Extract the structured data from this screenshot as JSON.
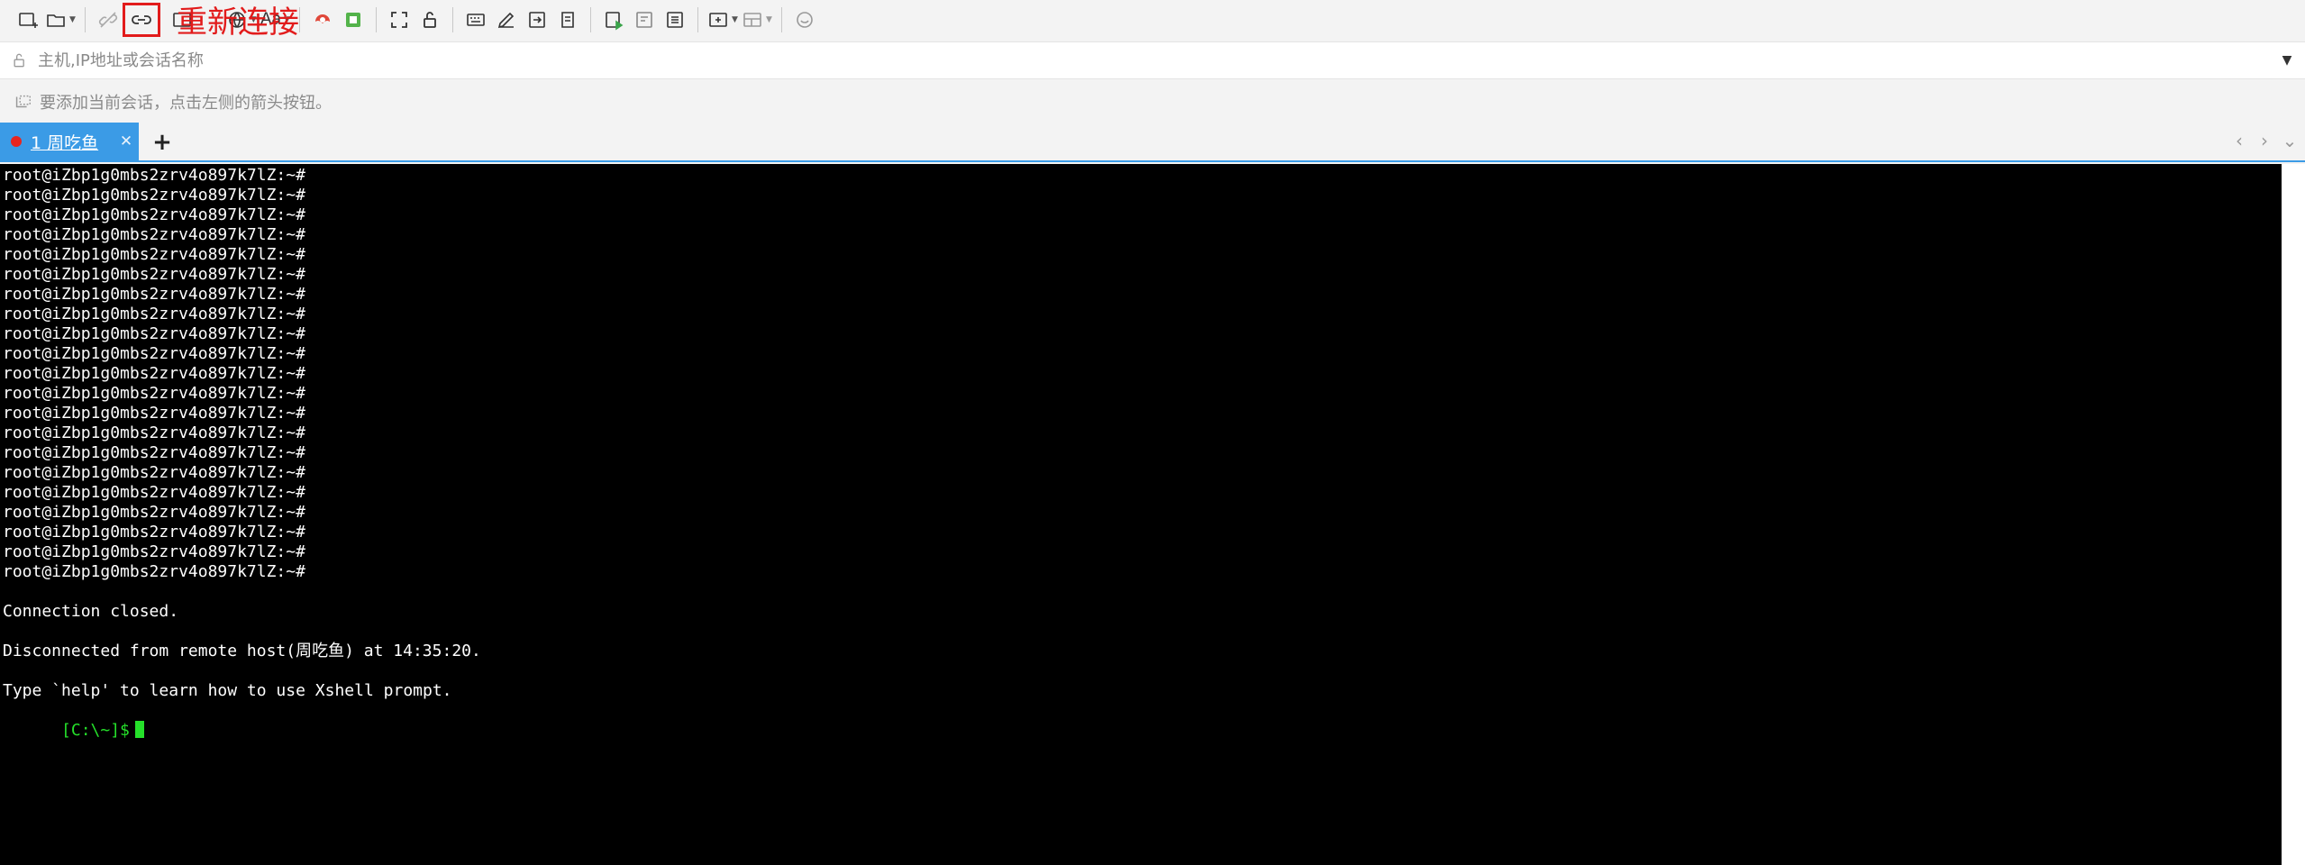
{
  "annotation": "重新连接",
  "toolbar": {
    "font_button": "Aa",
    "icons": [
      "new-session-icon",
      "open-folder-icon",
      "disconnect-icon",
      "reconnect-icon",
      "properties-icon",
      "globe-icon",
      "font-icon",
      "xftp-icon",
      "xmanager-icon",
      "fullscreen-icon",
      "lock-icon",
      "keyboard-icon",
      "script-icon",
      "transfer-icon",
      "log-icon",
      "compose-icon",
      "compose-bar-icon",
      "notes-icon",
      "new-tab-icon",
      "layout-icon",
      "chat-icon"
    ]
  },
  "address": {
    "placeholder": "主机,IP地址或会话名称"
  },
  "hint": {
    "text": "要添加当前会话，点击左侧的箭头按钮。"
  },
  "tabs": [
    {
      "label": "1 周吃鱼",
      "status_color": "#e8251f"
    }
  ],
  "tab_controls": {
    "add": "+",
    "prev": "‹",
    "next": "›",
    "menu": "⌄"
  },
  "terminal": {
    "lines": [
      "root@iZbp1g0mbs2zrv4o897k7lZ:~#",
      "root@iZbp1g0mbs2zrv4o897k7lZ:~#",
      "root@iZbp1g0mbs2zrv4o897k7lZ:~#",
      "root@iZbp1g0mbs2zrv4o897k7lZ:~#",
      "root@iZbp1g0mbs2zrv4o897k7lZ:~#",
      "root@iZbp1g0mbs2zrv4o897k7lZ:~#",
      "root@iZbp1g0mbs2zrv4o897k7lZ:~#",
      "root@iZbp1g0mbs2zrv4o897k7lZ:~#",
      "root@iZbp1g0mbs2zrv4o897k7lZ:~#",
      "root@iZbp1g0mbs2zrv4o897k7lZ:~#",
      "root@iZbp1g0mbs2zrv4o897k7lZ:~#",
      "root@iZbp1g0mbs2zrv4o897k7lZ:~#",
      "root@iZbp1g0mbs2zrv4o897k7lZ:~#",
      "root@iZbp1g0mbs2zrv4o897k7lZ:~#",
      "root@iZbp1g0mbs2zrv4o897k7lZ:~#",
      "root@iZbp1g0mbs2zrv4o897k7lZ:~#",
      "root@iZbp1g0mbs2zrv4o897k7lZ:~#",
      "root@iZbp1g0mbs2zrv4o897k7lZ:~#",
      "root@iZbp1g0mbs2zrv4o897k7lZ:~#",
      "root@iZbp1g0mbs2zrv4o897k7lZ:~#",
      "root@iZbp1g0mbs2zrv4o897k7lZ:~#",
      "",
      "Connection closed.",
      "",
      "Disconnected from remote host(周吃鱼) at 14:35:20.",
      "",
      "Type `help' to learn how to use Xshell prompt."
    ],
    "prompt": "[C:\\~]$",
    "prompt_color": "#25e02a"
  }
}
